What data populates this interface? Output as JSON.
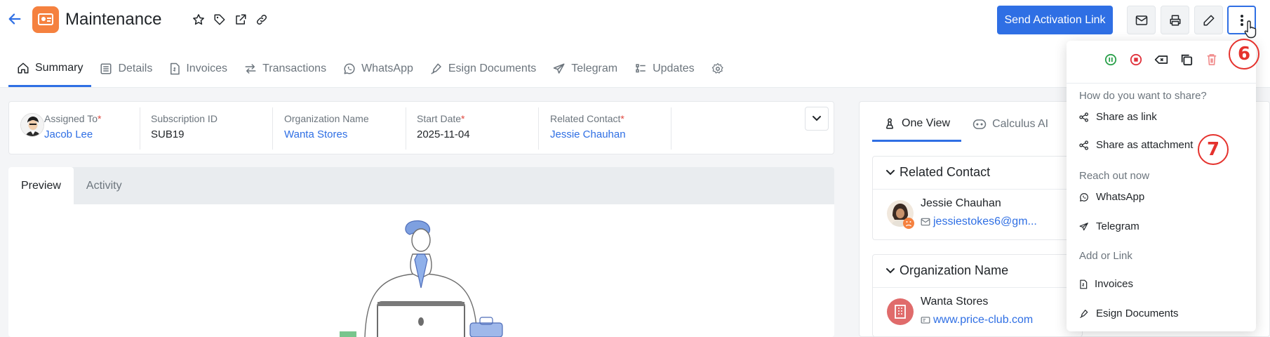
{
  "header": {
    "title": "Maintenance",
    "send_button": "Send Activation Link"
  },
  "tabs": [
    {
      "label": "Summary"
    },
    {
      "label": "Details"
    },
    {
      "label": "Invoices"
    },
    {
      "label": "Transactions"
    },
    {
      "label": "WhatsApp"
    },
    {
      "label": "Esign Documents"
    },
    {
      "label": "Telegram"
    },
    {
      "label": "Updates"
    }
  ],
  "info": {
    "assigned_to": {
      "label": "Assigned To",
      "value": "Jacob Lee"
    },
    "subscription_id": {
      "label": "Subscription ID",
      "value": "SUB19"
    },
    "organization_name": {
      "label": "Organization Name",
      "value": "Wanta Stores"
    },
    "start_date": {
      "label": "Start Date",
      "value": "2025-11-04"
    },
    "related_contact": {
      "label": "Related Contact",
      "value": "Jessie Chauhan"
    },
    "required_mark": "*"
  },
  "preview_tabs": [
    {
      "label": "Preview"
    },
    {
      "label": "Activity"
    }
  ],
  "right_tabs": [
    {
      "label": "One View"
    },
    {
      "label": "Calculus AI"
    }
  ],
  "related_contact_card": {
    "title": "Related Contact",
    "name": "Jessie Chauhan",
    "email": "jessiestokes6@gm..."
  },
  "organization_card": {
    "title": "Organization Name",
    "name": "Wanta Stores",
    "website": "www.price-club.com"
  },
  "dropdown": {
    "share_heading": "How do you want to share?",
    "share_link": "Share as link",
    "share_attachment": "Share as attachment",
    "reach_heading": "Reach out now",
    "whatsapp": "WhatsApp",
    "telegram": "Telegram",
    "add_heading": "Add or Link",
    "invoices": "Invoices",
    "esign": "Esign Documents"
  },
  "callouts": {
    "step6": "6",
    "step7": "7"
  },
  "colors": {
    "accent": "#2f6fe4",
    "logo": "#f5813f",
    "callout": "#e5322d",
    "resume": "#2aa04a",
    "stop": "#e0303a",
    "delete": "#f08a8a"
  },
  "icons": {
    "back": "arrow-left-icon",
    "star": "star-icon",
    "tag": "tag-icon",
    "external": "external-link-icon",
    "link": "link-icon",
    "mail": "mail-icon",
    "print": "printer-icon",
    "edit": "pencil-icon",
    "more": "more-vertical-icon"
  }
}
